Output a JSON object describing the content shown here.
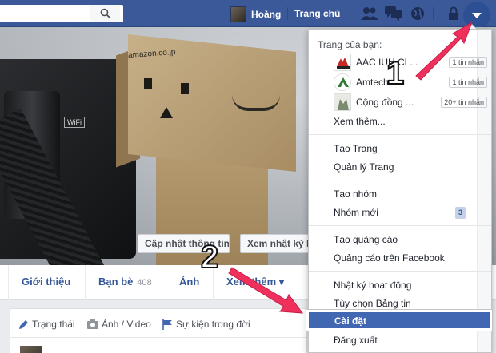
{
  "topbar": {
    "search_placeholder": "",
    "user_name": "Hoàng",
    "home_label": "Trang chủ"
  },
  "cover": {
    "box_text": "amazon.co.jp",
    "camera_label": "WiFi",
    "update_info_button": "Cập nhật thông tin",
    "activity_log_button": "Xem nhật ký hoạt động"
  },
  "nav": {
    "about": "Giới thiệu",
    "friends": "Bạn bè",
    "friends_count": "408",
    "photos": "Ảnh",
    "more": "Xem thêm ▾"
  },
  "composer": {
    "status": "Trạng thái",
    "photo_video": "Ảnh / Video",
    "life_event": "Sự kiện trong đời"
  },
  "dropdown": {
    "your_pages_header": "Trang của bạn:",
    "pages": [
      {
        "name": "AAC IUH CL...",
        "badge": "1 tin nhắn"
      },
      {
        "name": "Amtech",
        "badge": "1 tin nhắn"
      },
      {
        "name": "Cộng đồng ...",
        "badge": "20+ tin nhắn"
      }
    ],
    "see_more": "Xem thêm...",
    "create_page": "Tạo Trang",
    "manage_pages": "Quản lý Trang",
    "create_group": "Tạo nhóm",
    "new_groups": "Nhóm mới",
    "new_groups_count": "3",
    "create_ad": "Tạo quảng cáo",
    "ads_on_facebook": "Quảng cáo trên Facebook",
    "activity_log": "Nhật ký hoạt động",
    "news_feed_prefs": "Tùy chọn Bảng tin",
    "settings": "Cài đặt",
    "logout": "Đăng xuất"
  },
  "annotations": {
    "step1": "1",
    "step2": "2"
  },
  "colors": {
    "facebook_blue": "#3b5998",
    "highlight_blue": "#4267b2",
    "annotation_pink": "#f0305c"
  }
}
